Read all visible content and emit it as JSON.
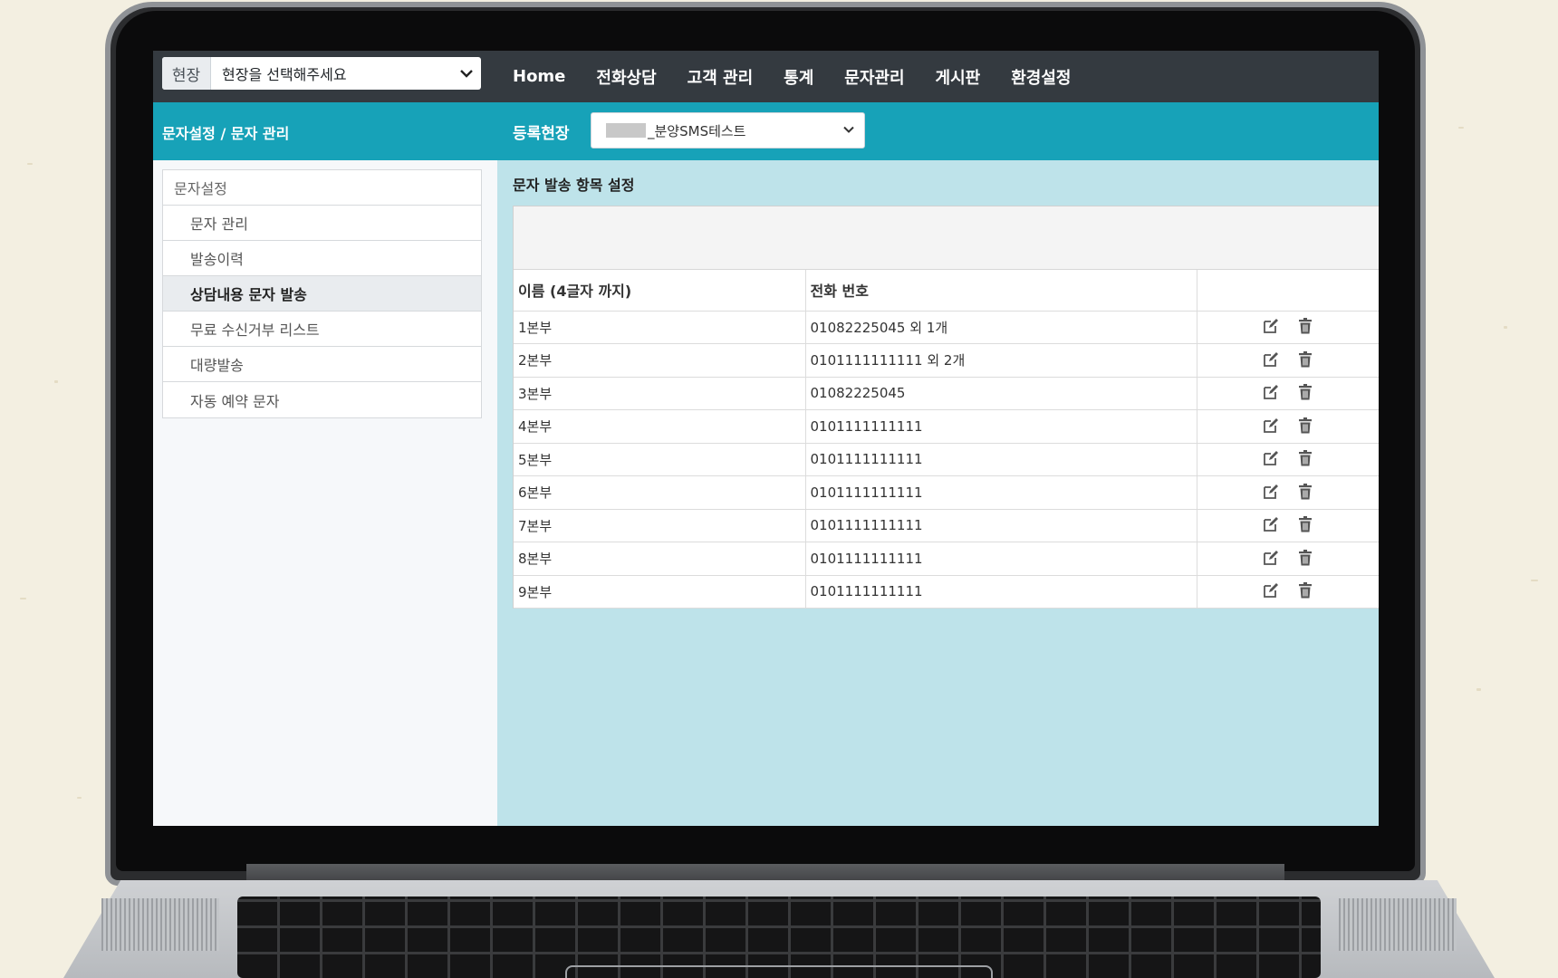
{
  "topnav": {
    "site_addon": "현장",
    "site_value": "현장을 선택해주세요",
    "menu": [
      "Home",
      "전화상담",
      "고객 관리",
      "통계",
      "문자관리",
      "게시판",
      "환경설정"
    ]
  },
  "subheader": {
    "breadcrumb": "문자설정 / 문자 관리",
    "reg_label": "등록현장",
    "reg_value": "_분양SMS테스트"
  },
  "sidebar": {
    "header": "문자설정",
    "items": [
      "문자 관리",
      "발송이력",
      "상담내용 문자 발송",
      "무료 수신거부 리스트",
      "대량발송",
      "자동 예약 문자"
    ],
    "active_index": 2
  },
  "main": {
    "section_title": "문자 발송 항목 설정",
    "columns": [
      "이름 (4글자 까지)",
      "전화 번호",
      ""
    ],
    "rows": [
      {
        "name": "1본부",
        "phone": "01082225045 외 1개"
      },
      {
        "name": "2본부",
        "phone": "0101111111111 외 2개"
      },
      {
        "name": "3본부",
        "phone": "01082225045"
      },
      {
        "name": "4본부",
        "phone": "0101111111111"
      },
      {
        "name": "5본부",
        "phone": "0101111111111"
      },
      {
        "name": "6본부",
        "phone": "0101111111111"
      },
      {
        "name": "7본부",
        "phone": "0101111111111"
      },
      {
        "name": "8본부",
        "phone": "0101111111111"
      },
      {
        "name": "9본부",
        "phone": "0101111111111"
      }
    ],
    "row_icons": [
      "edit-icon",
      "trash-icon"
    ]
  },
  "colors": {
    "topnav_bg": "#343a40",
    "accent": "#17a2b8",
    "main_bg": "#bee3ea",
    "icon": "#555555"
  }
}
